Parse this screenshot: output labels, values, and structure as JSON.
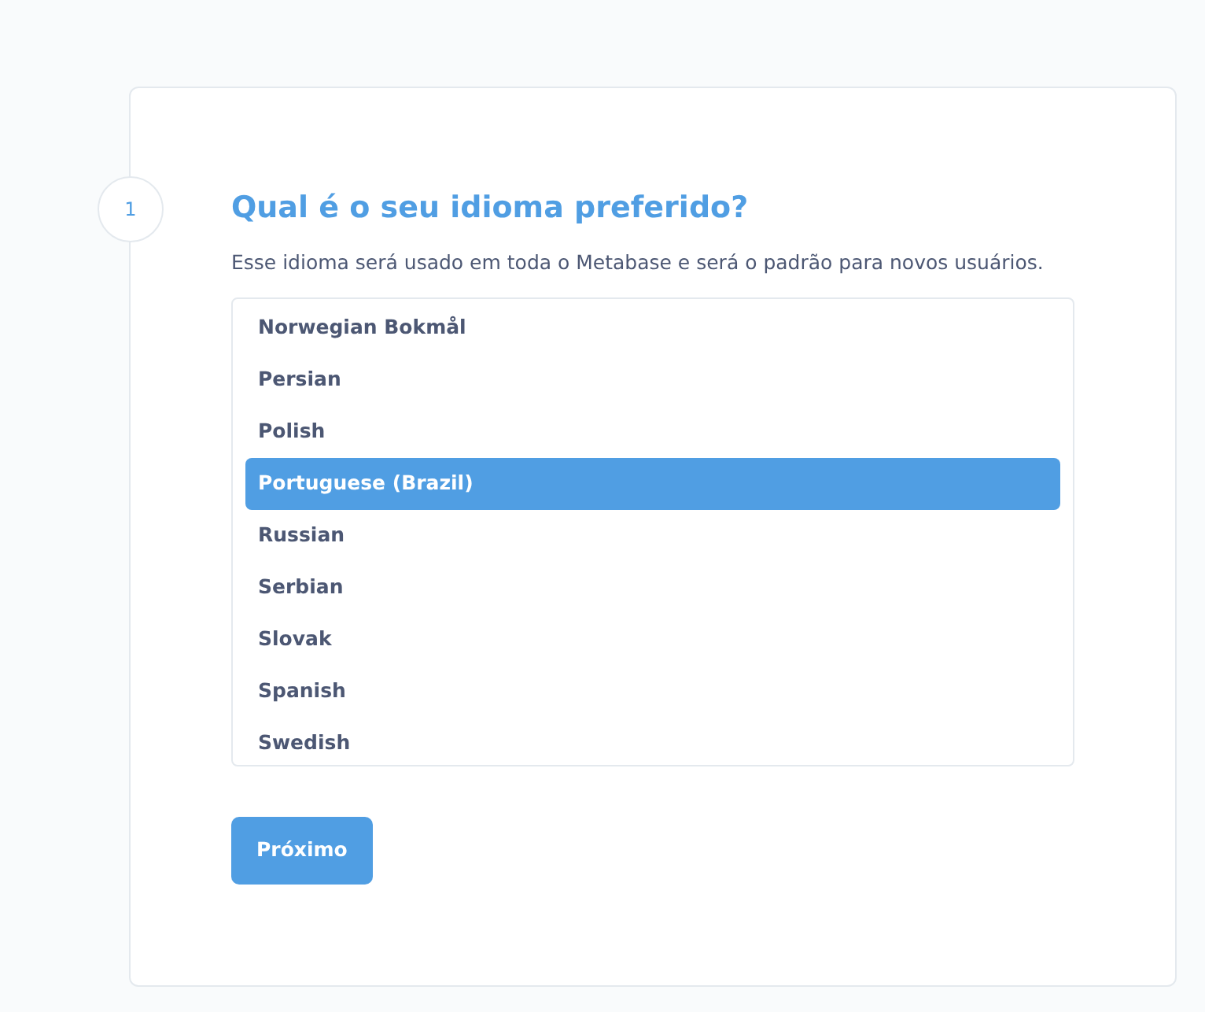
{
  "step": {
    "number": "1"
  },
  "title": "Qual é o seu idioma preferido?",
  "description": "Esse idioma será usado em toda o Metabase e será o padrão para novos usuários.",
  "languages": [
    {
      "label": "Norwegian Bokmål",
      "selected": false
    },
    {
      "label": "Persian",
      "selected": false
    },
    {
      "label": "Polish",
      "selected": false
    },
    {
      "label": "Portuguese (Brazil)",
      "selected": true
    },
    {
      "label": "Russian",
      "selected": false
    },
    {
      "label": "Serbian",
      "selected": false
    },
    {
      "label": "Slovak",
      "selected": false
    },
    {
      "label": "Spanish",
      "selected": false
    },
    {
      "label": "Swedish",
      "selected": false
    }
  ],
  "next_button": "Próximo"
}
